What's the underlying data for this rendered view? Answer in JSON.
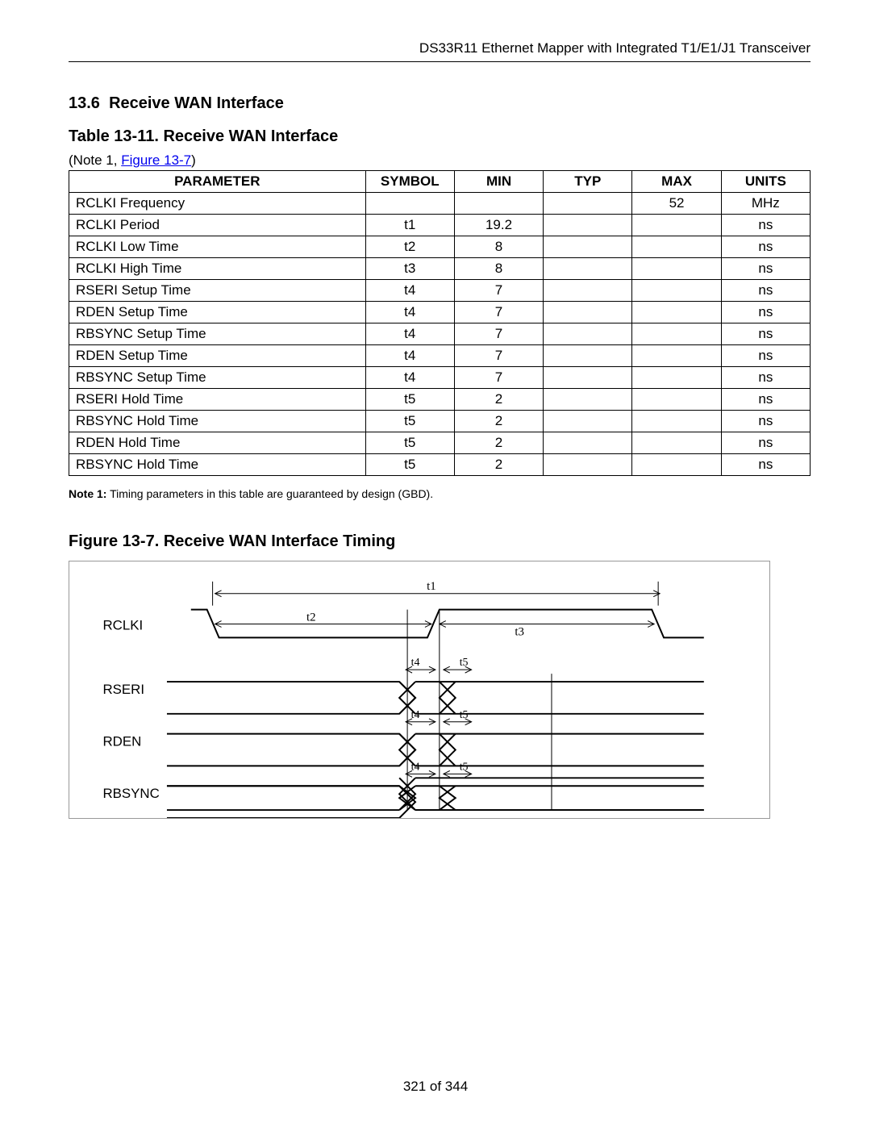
{
  "header": {
    "title": "DS33R11 Ethernet Mapper with Integrated T1/E1/J1 Transceiver"
  },
  "section": {
    "number": "13.6",
    "title": "Receive WAN Interface"
  },
  "table": {
    "caption": "Table 13-11. Receive WAN Interface",
    "note_link_prefix": "(Note 1, ",
    "note_link_text": "Figure 13-7",
    "note_link_suffix": ")",
    "columns": {
      "parameter": "PARAMETER",
      "symbol": "SYMBOL",
      "min": "MIN",
      "typ": "TYP",
      "max": "MAX",
      "units": "UNITS"
    },
    "rows": [
      {
        "parameter": "RCLKI Frequency",
        "symbol": "",
        "min": "",
        "typ": "",
        "max": "52",
        "units": "MHz"
      },
      {
        "parameter": "RCLKI Period",
        "symbol": "t1",
        "min": "19.2",
        "typ": "",
        "max": "",
        "units": "ns"
      },
      {
        "parameter": "RCLKI Low Time",
        "symbol": "t2",
        "min": "8",
        "typ": "",
        "max": "",
        "units": "ns"
      },
      {
        "parameter": "RCLKI High Time",
        "symbol": "t3",
        "min": "8",
        "typ": "",
        "max": "",
        "units": "ns"
      },
      {
        "parameter": "RSERI Setup Time",
        "symbol": "t4",
        "min": "7",
        "typ": "",
        "max": "",
        "units": "ns"
      },
      {
        "parameter": "RDEN Setup Time",
        "symbol": "t4",
        "min": "7",
        "typ": "",
        "max": "",
        "units": "ns"
      },
      {
        "parameter": "RBSYNC Setup Time",
        "symbol": "t4",
        "min": "7",
        "typ": "",
        "max": "",
        "units": "ns"
      },
      {
        "parameter": "RDEN Setup Time",
        "symbol": "t4",
        "min": "7",
        "typ": "",
        "max": "",
        "units": "ns"
      },
      {
        "parameter": "RBSYNC Setup Time",
        "symbol": "t4",
        "min": "7",
        "typ": "",
        "max": "",
        "units": "ns"
      },
      {
        "parameter": "RSERI Hold Time",
        "symbol": "t5",
        "min": "2",
        "typ": "",
        "max": "",
        "units": "ns"
      },
      {
        "parameter": "RBSYNC Hold Time",
        "symbol": "t5",
        "min": "2",
        "typ": "",
        "max": "",
        "units": "ns"
      },
      {
        "parameter": "RDEN Hold Time",
        "symbol": "t5",
        "min": "2",
        "typ": "",
        "max": "",
        "units": "ns"
      },
      {
        "parameter": "RBSYNC Hold Time",
        "symbol": "t5",
        "min": "2",
        "typ": "",
        "max": "",
        "units": "ns"
      }
    ],
    "footnote_label": "Note 1:",
    "footnote_text": " Timing parameters in this table are guaranteed by design (GBD)."
  },
  "figure": {
    "caption": "Figure 13-7. Receive WAN Interface Timing",
    "signals": {
      "rclki": "RCLKI",
      "rseri": "RSERI",
      "rden": "RDEN",
      "rbsync": "RBSYNC"
    },
    "labels": {
      "t1": "t1",
      "t2": "t2",
      "t3": "t3",
      "t4": "t4",
      "t5": "t5"
    }
  },
  "footer": {
    "page": "321 of 344"
  }
}
